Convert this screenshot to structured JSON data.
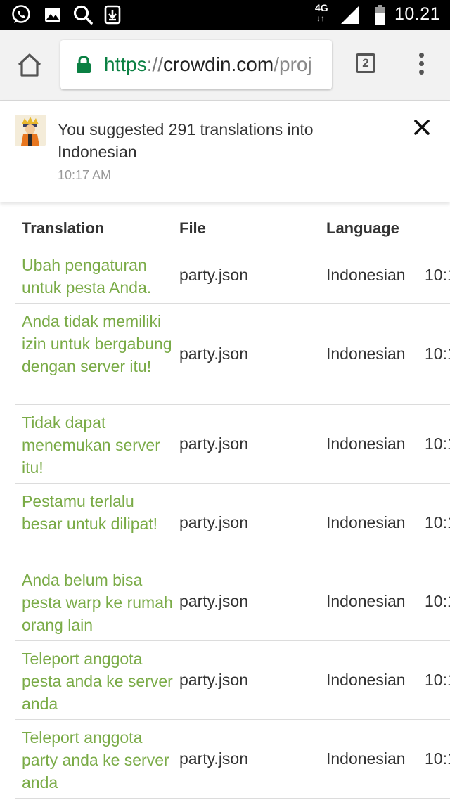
{
  "status_bar": {
    "icons": [
      "whatsapp-icon",
      "gallery-icon",
      "search-icon",
      "download-icon"
    ],
    "network": "4G",
    "clock": "10.21"
  },
  "browser": {
    "url_scheme": "https",
    "url_sep": "://",
    "url_host": "crowdin.com",
    "url_path": "/proj",
    "tab_count": "2"
  },
  "notification": {
    "message": "You suggested 291 translations into Indonesian",
    "time": "10:17 AM"
  },
  "table": {
    "headers": [
      "Translation",
      "File",
      "Language",
      ""
    ],
    "rows": [
      {
        "translation": "Ubah pengaturan untuk pesta Anda.",
        "file": "party.json",
        "language": "Indonesian",
        "time": "10:1"
      },
      {
        "translation": "Anda tidak memiliki izin untuk bergabung dengan server itu!",
        "file": "party.json",
        "language": "Indonesian",
        "time": "10:1"
      },
      {
        "translation": "Tidak dapat menemukan server itu!",
        "file": "party.json",
        "language": "Indonesian",
        "time": "10:1"
      },
      {
        "translation": "Pestamu terlalu besar untuk dilipat!",
        "file": "party.json",
        "language": "Indonesian",
        "time": "10:1"
      },
      {
        "translation": "Anda belum bisa pesta warp ke rumah orang lain",
        "file": "party.json",
        "language": "Indonesian",
        "time": "10:1"
      },
      {
        "translation": "Teleport anggota pesta anda ke server anda",
        "file": "party.json",
        "language": "Indonesian",
        "time": "10:1"
      },
      {
        "translation": "Teleport anggota party anda ke server anda",
        "file": "party.json",
        "language": "Indonesian",
        "time": "10:1"
      }
    ]
  },
  "colors": {
    "link_green": "#7aab47",
    "secure_green": "#0b8043"
  }
}
